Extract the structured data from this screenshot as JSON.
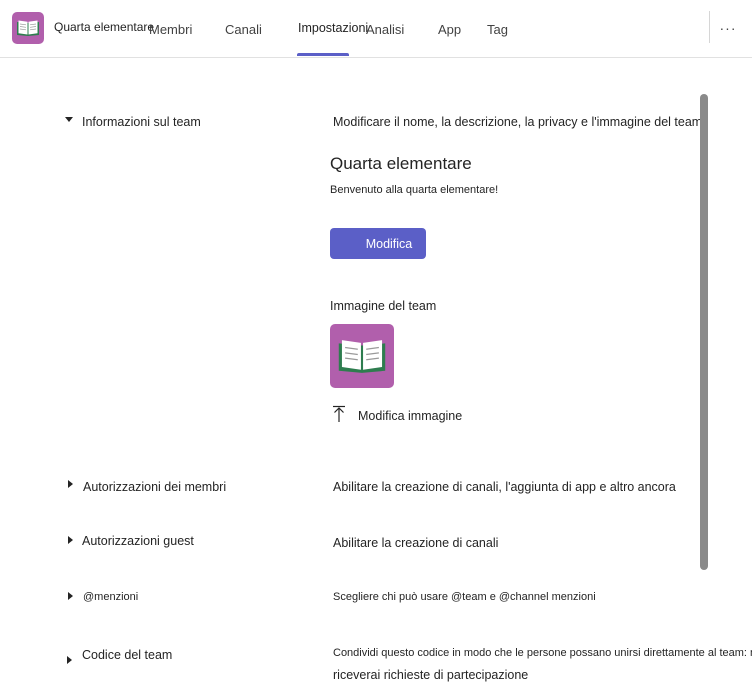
{
  "header": {
    "team_name": "Quarta elementare",
    "tabs": [
      {
        "label": "Membri"
      },
      {
        "label": "Canali"
      },
      {
        "label": "Impostazioni"
      },
      {
        "label": "Analisi"
      },
      {
        "label": "App"
      },
      {
        "label": "Tag"
      }
    ],
    "active_tab": "Impostazioni",
    "more_label": "···",
    "team_icon": "book-icon"
  },
  "sections": {
    "team_info": {
      "label": "Informazioni sul team",
      "description": "Modificare il nome, la descrizione, la privacy e l'immagine del team",
      "expanded": true,
      "team_title": "Quarta elementare",
      "team_description": "Benvenuto alla quarta elementare!",
      "edit_label": "Modifica",
      "image_label": "Immagine del team",
      "change_image_label": "Modifica immagine"
    },
    "member_permissions": {
      "label": "Autorizzazioni dei membri",
      "description": "Abilitare la creazione di canali, l'aggiunta di app e altro ancora"
    },
    "guest_permissions": {
      "label": "Autorizzazioni guest",
      "description": "Abilitare la creazione di canali"
    },
    "mentions": {
      "label": "@menzioni",
      "description": "Scegliere chi può usare @team e @channel menzioni"
    },
    "team_code": {
      "label": "Codice del team",
      "description_line1": "Condividi questo codice in modo che le persone possano unirsi direttamente al team: non",
      "description_line2": "riceverai richieste di partecipazione"
    }
  },
  "colors": {
    "accent": "#5b5fc7",
    "team_avatar_bg": "#b15fac",
    "book_cover": "#2e7d4f",
    "book_pages": "#ffffff"
  }
}
